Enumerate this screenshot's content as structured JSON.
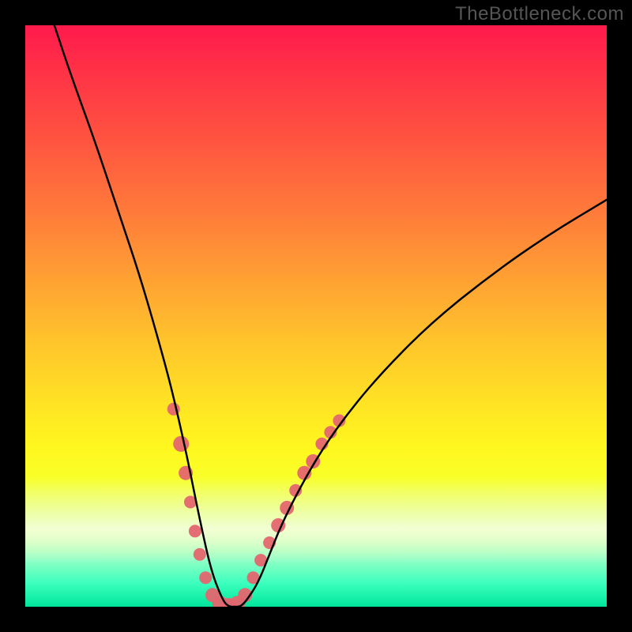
{
  "watermark": "TheBottleneck.com",
  "chart_data": {
    "type": "line",
    "title": "",
    "xlabel": "",
    "ylabel": "",
    "xlim": [
      0,
      100
    ],
    "ylim": [
      0,
      100
    ],
    "grid": false,
    "legend": false,
    "y_axis_meaning": "bottleneck percentage (top=high/red, bottom=low/green)",
    "x_axis_meaning": "component performance index",
    "gradient_stops": [
      {
        "pos": 0,
        "color": "#ff1a4c"
      },
      {
        "pos": 8,
        "color": "#ff3246"
      },
      {
        "pos": 20,
        "color": "#ff5540"
      },
      {
        "pos": 32,
        "color": "#ff7a3a"
      },
      {
        "pos": 44,
        "color": "#ffa233"
      },
      {
        "pos": 55,
        "color": "#ffc62b"
      },
      {
        "pos": 65,
        "color": "#ffe324"
      },
      {
        "pos": 73,
        "color": "#fff81e"
      },
      {
        "pos": 78,
        "color": "#f8ff2a"
      },
      {
        "pos": 82,
        "color": "#e8ff55"
      },
      {
        "pos": 87,
        "color": "#c8ff90"
      },
      {
        "pos": 92,
        "color": "#8effc5"
      },
      {
        "pos": 96,
        "color": "#3bffbd"
      },
      {
        "pos": 100,
        "color": "#00e59a"
      }
    ],
    "series": [
      {
        "name": "bottleneck-curve",
        "color": "#000000",
        "x": [
          5,
          8,
          12,
          16,
          20,
          24,
          26,
          28,
          30,
          32,
          34,
          35,
          36,
          37,
          38,
          40,
          42,
          44,
          47,
          51,
          56,
          62,
          70,
          80,
          90,
          100
        ],
        "y": [
          100,
          91,
          80,
          68,
          56,
          42,
          34,
          25,
          15,
          6,
          1,
          0,
          0,
          0,
          1,
          4,
          9,
          14,
          20,
          27,
          34,
          41,
          49,
          57,
          64,
          70
        ]
      }
    ],
    "highlighted_points": {
      "name": "scatter-overlay",
      "color": "#e4666f",
      "points": [
        {
          "x": 25.5,
          "y": 34,
          "r": 8
        },
        {
          "x": 26.8,
          "y": 28,
          "r": 10
        },
        {
          "x": 27.6,
          "y": 23,
          "r": 9
        },
        {
          "x": 28.4,
          "y": 18,
          "r": 8
        },
        {
          "x": 29.2,
          "y": 13,
          "r": 8
        },
        {
          "x": 30.0,
          "y": 9,
          "r": 8
        },
        {
          "x": 31.0,
          "y": 5,
          "r": 8
        },
        {
          "x": 32.2,
          "y": 2,
          "r": 9
        },
        {
          "x": 33.5,
          "y": 0.5,
          "r": 10
        },
        {
          "x": 35.0,
          "y": 0,
          "r": 11
        },
        {
          "x": 36.5,
          "y": 0.5,
          "r": 10
        },
        {
          "x": 37.8,
          "y": 2,
          "r": 9
        },
        {
          "x": 39.2,
          "y": 5,
          "r": 8
        },
        {
          "x": 40.5,
          "y": 8,
          "r": 8
        },
        {
          "x": 42.0,
          "y": 11,
          "r": 8
        },
        {
          "x": 43.5,
          "y": 14,
          "r": 9
        },
        {
          "x": 45.0,
          "y": 17,
          "r": 9
        },
        {
          "x": 46.5,
          "y": 20,
          "r": 8
        },
        {
          "x": 48.0,
          "y": 23,
          "r": 9
        },
        {
          "x": 49.5,
          "y": 25,
          "r": 9
        },
        {
          "x": 51.0,
          "y": 28,
          "r": 8
        },
        {
          "x": 52.5,
          "y": 30,
          "r": 8
        },
        {
          "x": 54.0,
          "y": 32,
          "r": 8
        }
      ]
    }
  }
}
